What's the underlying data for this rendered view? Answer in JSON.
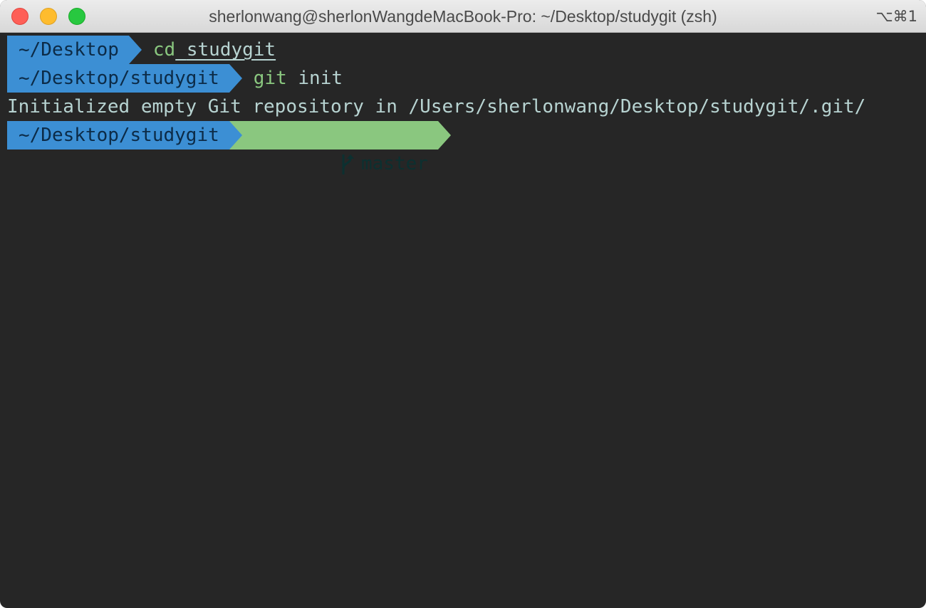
{
  "window": {
    "title": "sherlonwang@sherlonWangdeMacBook-Pro: ~/Desktop/studygit (zsh)",
    "shortcut": "⌥⌘1"
  },
  "colors": {
    "background": "#262626",
    "prompt_dir_bg": "#3c8fd4",
    "prompt_git_bg": "#8ac77f",
    "command": "#8ac77f",
    "text": "#b7d3d1"
  },
  "lines": [
    {
      "dir": "~/Desktop",
      "command": "cd",
      "args": "studygit"
    },
    {
      "dir": "~/Desktop/studygit",
      "command": "git",
      "args": "init"
    },
    {
      "output": "Initialized empty Git repository in /Users/sherlonwang/Desktop/studygit/.git/"
    },
    {
      "dir": "~/Desktop/studygit",
      "branch_icon": "git-branch-icon",
      "branch": "master"
    }
  ]
}
